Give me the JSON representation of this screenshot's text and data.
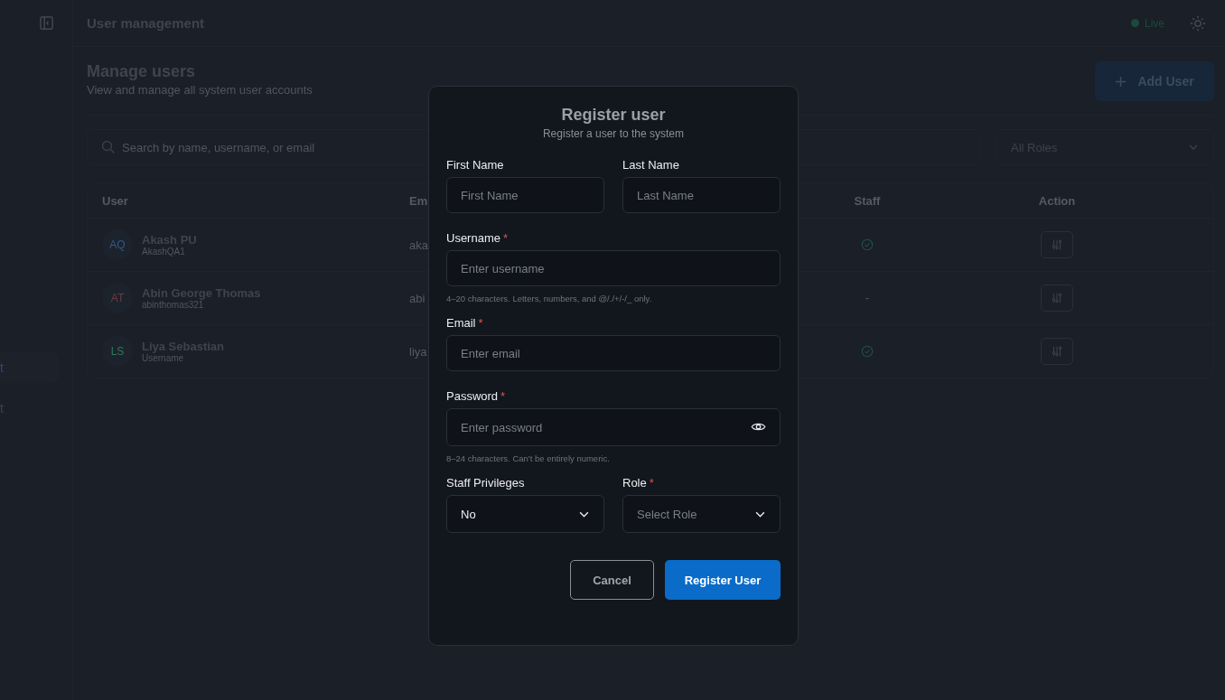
{
  "sidebar": {
    "items": [
      {
        "label": "t",
        "selected": true
      },
      {
        "label": "t",
        "selected": false
      }
    ]
  },
  "header": {
    "title": "User management",
    "status": "Live"
  },
  "page": {
    "title": "Manage users",
    "subtitle": "View and manage all system user accounts",
    "add_button": "Add User"
  },
  "filters": {
    "search_placeholder": "Search by name, username, or email",
    "role_filter": "All Roles"
  },
  "table": {
    "columns": [
      "User",
      "Em",
      "Staff",
      "Action"
    ],
    "rows": [
      {
        "initials": "AQ",
        "color": "#2e5a86",
        "name": "Akash PU",
        "username": "AkashQA1",
        "email": "aka",
        "staff": true
      },
      {
        "initials": "AT",
        "color": "#6a3a46",
        "name": "Abin George Thomas",
        "username": "abinthomas321",
        "email": "abi",
        "staff": false,
        "staff_text": "-"
      },
      {
        "initials": "LS",
        "color": "#2f7a5e",
        "name": "Liya Sebastian",
        "username": "Username",
        "email": "liya",
        "staff": true
      }
    ]
  },
  "dialog": {
    "title": "Register user",
    "subtitle": "Register a user to the system",
    "rows": [
      {
        "fields": [
          {
            "kind": "text",
            "label": "First Name",
            "placeholder": "First Name"
          },
          {
            "kind": "text",
            "label": "Last Name",
            "placeholder": "Last Name"
          }
        ]
      },
      {
        "fields": [
          {
            "kind": "text",
            "label": "Username",
            "required_mark": "*",
            "placeholder": "Enter username",
            "hint": "4–20 characters. Letters, numbers, and @/./+/-/_ only."
          }
        ]
      },
      {
        "fields": [
          {
            "kind": "text",
            "label": "Email",
            "required_mark": "*",
            "placeholder": "Enter email"
          }
        ]
      },
      {
        "fields": [
          {
            "kind": "password",
            "label": "Password",
            "required_mark": "*",
            "placeholder": "Enter password",
            "hint": "8–24 characters. Can't be entirely numeric."
          }
        ]
      },
      {
        "fields": [
          {
            "kind": "select",
            "label": "Staff Privileges",
            "value": "No"
          },
          {
            "kind": "select",
            "label": "Role",
            "required_mark": "*",
            "placeholder": "Select Role"
          }
        ]
      }
    ],
    "buttons": [
      {
        "kind": "outline",
        "label": "Cancel"
      },
      {
        "kind": "primary",
        "label": "Register User"
      }
    ]
  }
}
